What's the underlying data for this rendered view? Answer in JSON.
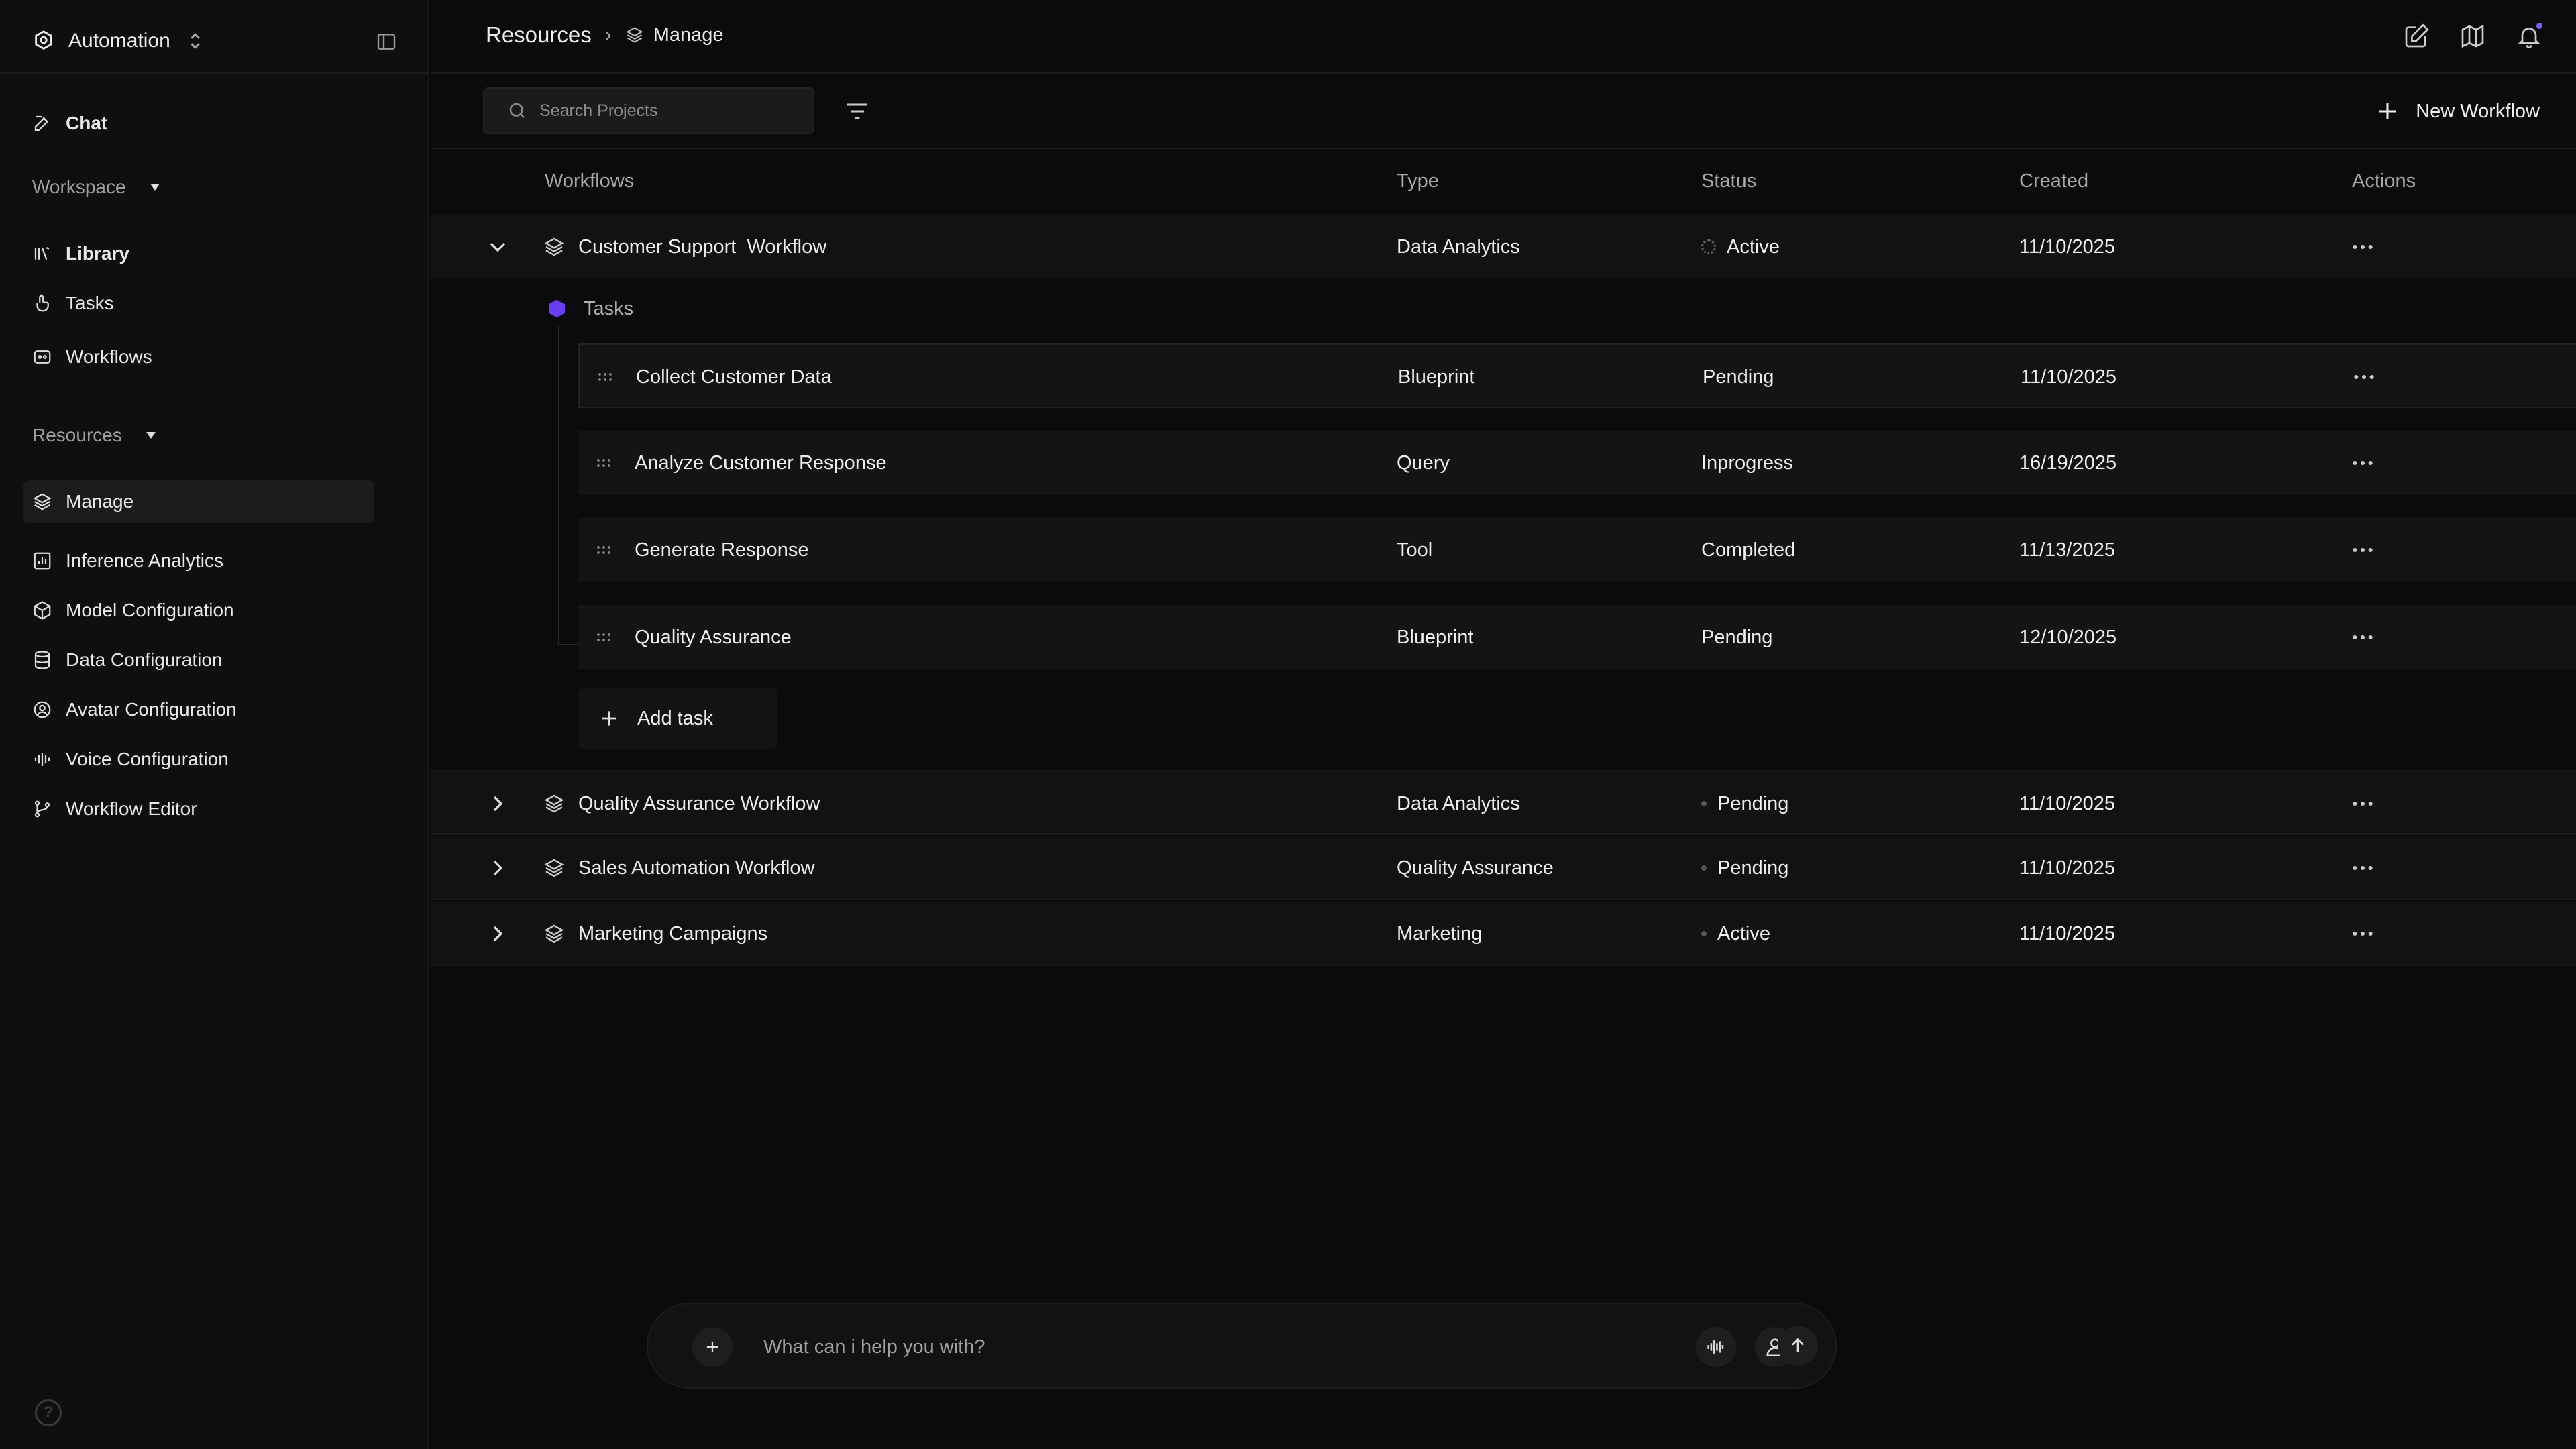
{
  "sidebar": {
    "brand": "Automation",
    "chat": "Chat",
    "workspace_label": "Workspace",
    "workspace_items": [
      "Library",
      "Tasks",
      "Workflows"
    ],
    "resources_label": "Resources",
    "resources_items": [
      "Manage",
      "Inference Analytics",
      "Model Configuration",
      "Data Configuration",
      "Avatar Configuration",
      "Voice Configuration",
      "Workflow Editor"
    ],
    "help": "?"
  },
  "header": {
    "breadcrumb_root": "Resources",
    "breadcrumb_current": "Manage"
  },
  "toolbar": {
    "search_placeholder": "Search Projects",
    "new_workflow": "New Workflow"
  },
  "table": {
    "columns": [
      "Workflows",
      "Type",
      "Status",
      "Created",
      "Actions"
    ],
    "expanded": {
      "name": "Customer Support  Workflow",
      "type": "Data Analytics",
      "status": "Active",
      "created": "11/10/2025",
      "tasks_label": "Tasks",
      "tasks": [
        {
          "name": "Collect Customer Data",
          "type": "Blueprint",
          "status": "Pending",
          "created": "11/10/2025"
        },
        {
          "name": "Analyze Customer Response",
          "type": "Query",
          "status": "Inprogress",
          "created": "16/19/2025"
        },
        {
          "name": "Generate Response",
          "type": "Tool",
          "status": "Completed",
          "created": "11/13/2025"
        },
        {
          "name": "Quality Assurance",
          "type": "Blueprint",
          "status": "Pending",
          "created": "12/10/2025"
        }
      ],
      "add_task": "Add task"
    },
    "collapsed": [
      {
        "name": "Quality Assurance Workflow",
        "type": "Data Analytics",
        "status": "Pending",
        "created": "11/10/2025"
      },
      {
        "name": "Sales Automation Workflow",
        "type": "Quality Assurance",
        "status": "Pending",
        "created": "11/10/2025"
      },
      {
        "name": "Marketing Campaigns",
        "type": "Marketing",
        "status": "Active",
        "created": "11/10/2025"
      }
    ]
  },
  "chat": {
    "placeholder": "What can i help you with?"
  },
  "colors": {
    "background": "#0b0b0b",
    "sidebar": "#0f0f0f",
    "accent": "#7c5cff",
    "task_icon": "#6a3df5"
  },
  "icons": [
    "automation-logo-icon",
    "sidebar-toggle-icon",
    "edit-icon",
    "book-icon",
    "hand-icon",
    "workflow-icon",
    "layers-icon",
    "chart-icon",
    "cube-icon",
    "database-icon",
    "user-circle-icon",
    "waveform-icon",
    "branch-icon",
    "map-icon",
    "bell-icon",
    "search-icon",
    "filter-icon",
    "plus-icon",
    "chevron-down-icon",
    "chevron-right-icon",
    "grip-icon",
    "more-icon",
    "hexagon-icon",
    "user-icon",
    "arrow-up-icon"
  ]
}
